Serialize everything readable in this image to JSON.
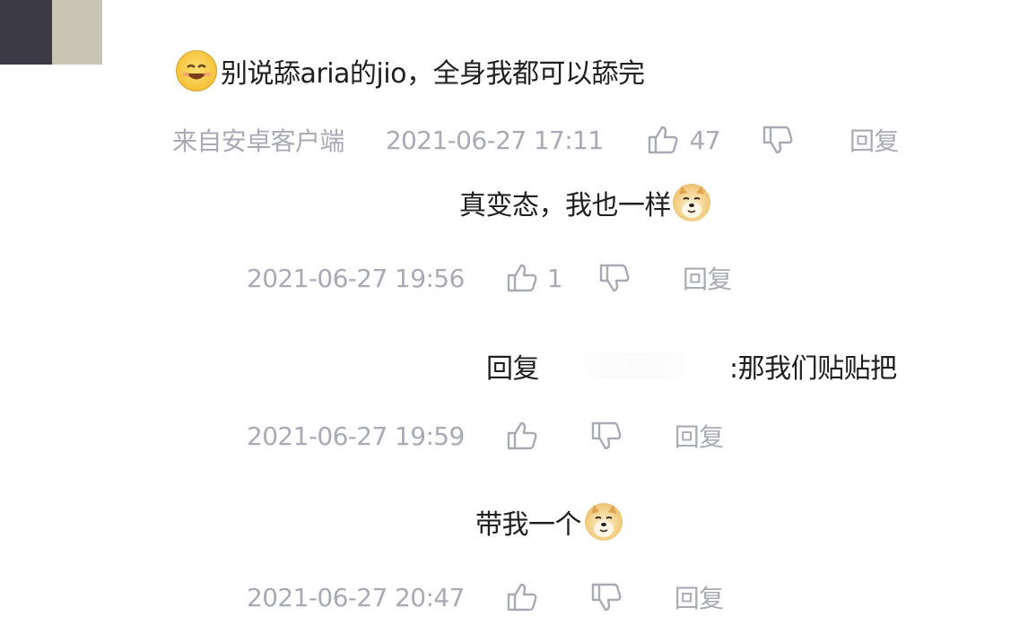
{
  "comments": [
    {
      "text": "别说舔aria的jio，全身我都可以舔完",
      "source": "来自安卓客户端",
      "timestamp": "2021-06-27 17:11",
      "likes": "47",
      "reply_label": "回复"
    },
    {
      "text": "真变态，我也一样",
      "timestamp": "2021-06-27 19:56",
      "likes": "1",
      "reply_label": "回复"
    },
    {
      "text_prefix": "回复",
      "text_suffix": ":那我们贴贴把",
      "timestamp": "2021-06-27 19:59",
      "likes": "",
      "reply_label": "回复"
    },
    {
      "text": "带我一个",
      "timestamp": "2021-06-27 20:47",
      "likes": "",
      "reply_label": "回复"
    }
  ],
  "icons": {
    "like": "thumbs-up-icon",
    "dislike": "thumbs-down-icon",
    "emoji_smile": "smiling-face-emoji",
    "emoji_doge": "doge-emoji"
  },
  "colors": {
    "text": "#1f1f1f",
    "meta": "#a8abb3",
    "background": "#ffffff"
  }
}
